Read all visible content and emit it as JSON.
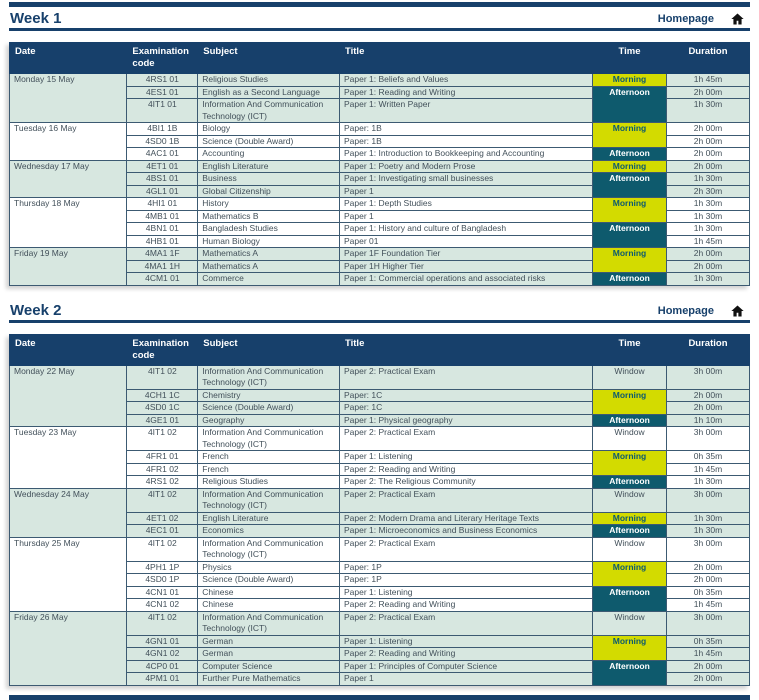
{
  "colors": {
    "navy": "#17406b",
    "row_mint": "#d7e7e0",
    "row_white": "#ffffff",
    "morning_bg": "#d3db00",
    "morning_text": "#0d5a6e",
    "afternoon_bg": "#0e5a6d",
    "afternoon_text": "#ffffff"
  },
  "columns": [
    "Date",
    "Examination code",
    "Subject",
    "Title",
    "Time",
    "Duration"
  ],
  "weeks": [
    {
      "title": "Week 1",
      "homepage_label": "Homepage",
      "days": [
        {
          "date": "Monday 15 May",
          "exams": [
            {
              "code": "4RS1 01",
              "subject": "Religious Studies",
              "title": "Paper 1: Beliefs and Values",
              "time": "Morning",
              "time_span": 1,
              "duration": "1h 45m"
            },
            {
              "code": "4ES1 01",
              "subject": "English as a Second Language",
              "title": "Paper 1: Reading and Writing",
              "time": "Afternoon",
              "time_span": 2,
              "duration": "2h 00m"
            },
            {
              "code": "4IT1 01",
              "subject": "Information And Communication Technology (ICT)",
              "title": "Paper 1: Written Paper",
              "duration": "1h 30m"
            }
          ]
        },
        {
          "date": "Tuesday 16 May",
          "exams": [
            {
              "code": "4BI1 1B",
              "subject": "Biology",
              "title": "Paper: 1B",
              "time": "Morning",
              "time_span": 2,
              "duration": "2h 00m"
            },
            {
              "code": "4SD0 1B",
              "subject": "Science (Double Award)",
              "title": "Paper: 1B",
              "duration": "2h 00m"
            },
            {
              "code": "4AC1 01",
              "subject": "Accounting",
              "title": "Paper 1: Introduction to Bookkeeping and Accounting",
              "time": "Afternoon",
              "time_span": 1,
              "duration": "2h 00m"
            }
          ]
        },
        {
          "date": "Wednesday 17 May",
          "exams": [
            {
              "code": "4ET1 01",
              "subject": "English Literature",
              "title": "Paper 1: Poetry and Modern Prose",
              "time": "Morning",
              "time_span": 1,
              "duration": "2h 00m"
            },
            {
              "code": "4BS1 01",
              "subject": "Business",
              "title": "Paper 1: Investigating small businesses",
              "time": "Afternoon",
              "time_span": 2,
              "duration": "1h 30m"
            },
            {
              "code": "4GL1 01",
              "subject": "Global Citizenship",
              "title": "Paper 1",
              "duration": "2h 30m"
            }
          ]
        },
        {
          "date": "Thursday 18 May",
          "exams": [
            {
              "code": "4HI1 01",
              "subject": "History",
              "title": "Paper 1: Depth Studies",
              "time": "Morning",
              "time_span": 2,
              "duration": "1h 30m"
            },
            {
              "code": "4MB1 01",
              "subject": "Mathematics B",
              "title": "Paper 1",
              "duration": "1h 30m"
            },
            {
              "code": "4BN1 01",
              "subject": "Bangladesh Studies",
              "title": "Paper 1: History and culture of Bangladesh",
              "time": "Afternoon",
              "time_span": 2,
              "duration": "1h 30m"
            },
            {
              "code": "4HB1 01",
              "subject": "Human Biology",
              "title": "Paper 01",
              "duration": "1h 45m"
            }
          ]
        },
        {
          "date": "Friday 19 May",
          "exams": [
            {
              "code": "4MA1 1F",
              "subject": "Mathematics A",
              "title": "Paper 1F Foundation Tier",
              "time": "Morning",
              "time_span": 2,
              "duration": "2h 00m"
            },
            {
              "code": "4MA1 1H",
              "subject": "Mathematics A",
              "title": "Paper 1H Higher Tier",
              "duration": "2h 00m"
            },
            {
              "code": "4CM1 01",
              "subject": "Commerce",
              "title": "Paper 1: Commercial operations and associated risks",
              "time": "Afternoon",
              "time_span": 1,
              "duration": "1h 30m"
            }
          ]
        }
      ]
    },
    {
      "title": "Week 2",
      "homepage_label": "Homepage",
      "days": [
        {
          "date": "Monday 22 May",
          "exams": [
            {
              "code": "4IT1 02",
              "subject": "Information And Communication Technology (ICT)",
              "title": "Paper 2: Practical Exam",
              "time": "Window",
              "time_span": 1,
              "duration": "3h 00m"
            },
            {
              "code": "4CH1 1C",
              "subject": "Chemistry",
              "title": "Paper: 1C",
              "time": "Morning",
              "time_span": 2,
              "duration": "2h 00m"
            },
            {
              "code": "4SD0 1C",
              "subject": "Science (Double Award)",
              "title": "Paper: 1C",
              "duration": "2h 00m"
            },
            {
              "code": "4GE1 01",
              "subject": "Geography",
              "title": "Paper 1: Physical geography",
              "time": "Afternoon",
              "time_span": 1,
              "duration": "1h 10m"
            }
          ]
        },
        {
          "date": "Tuesday 23 May",
          "exams": [
            {
              "code": "4IT1 02",
              "subject": "Information And Communication Technology (ICT)",
              "title": "Paper 2: Practical Exam",
              "time": "Window",
              "time_span": 1,
              "duration": "3h 00m"
            },
            {
              "code": "4FR1 01",
              "subject": "French",
              "title": "Paper 1: Listening",
              "time": "Morning",
              "time_span": 2,
              "duration": "0h 35m"
            },
            {
              "code": "4FR1 02",
              "subject": "French",
              "title": "Paper 2: Reading and Writing",
              "duration": "1h 45m"
            },
            {
              "code": "4RS1 02",
              "subject": "Religious Studies",
              "title": "Paper 2: The Religious Community",
              "time": "Afternoon",
              "time_span": 1,
              "duration": "1h 30m"
            }
          ]
        },
        {
          "date": "Wednesday 24 May",
          "exams": [
            {
              "code": "4IT1 02",
              "subject": "Information And Communication Technology (ICT)",
              "title": "Paper 2: Practical Exam",
              "time": "Window",
              "time_span": 1,
              "duration": "3h 00m"
            },
            {
              "code": "4ET1 02",
              "subject": "English Literature",
              "title": "Paper 2: Modern Drama and Literary Heritage Texts",
              "time": "Morning",
              "time_span": 1,
              "duration": "1h 30m"
            },
            {
              "code": "4EC1 01",
              "subject": "Economics",
              "title": "Paper 1: Microeconomics and Business Economics",
              "time": "Afternoon",
              "time_span": 1,
              "duration": "1h 30m"
            }
          ]
        },
        {
          "date": "Thursday 25 May",
          "exams": [
            {
              "code": "4IT1 02",
              "subject": "Information And Communication Technology (ICT)",
              "title": "Paper 2: Practical Exam",
              "time": "Window",
              "time_span": 1,
              "duration": "3h 00m"
            },
            {
              "code": "4PH1 1P",
              "subject": "Physics",
              "title": "Paper: 1P",
              "time": "Morning",
              "time_span": 2,
              "duration": "2h 00m"
            },
            {
              "code": "4SD0 1P",
              "subject": "Science (Double Award)",
              "title": "Paper: 1P",
              "duration": "2h 00m"
            },
            {
              "code": "4CN1 01",
              "subject": "Chinese",
              "title": "Paper 1: Listening",
              "time": "Afternoon",
              "time_span": 2,
              "duration": "0h 35m"
            },
            {
              "code": "4CN1 02",
              "subject": "Chinese",
              "title": "Paper 2: Reading and Writing",
              "duration": "1h 45m"
            }
          ]
        },
        {
          "date": "Friday 26 May",
          "exams": [
            {
              "code": "4IT1 02",
              "subject": "Information And Communication Technology (ICT)",
              "title": "Paper 2: Practical Exam",
              "time": "Window",
              "time_span": 1,
              "duration": "3h 00m"
            },
            {
              "code": "4GN1 01",
              "subject": "German",
              "title": "Paper 1: Listening",
              "time": "Morning",
              "time_span": 2,
              "duration": "0h 35m"
            },
            {
              "code": "4GN1 02",
              "subject": "German",
              "title": "Paper 2: Reading and Writing",
              "duration": "1h 45m"
            },
            {
              "code": "4CP0 01",
              "subject": "Computer Science",
              "title": "Paper 1: Principles of Computer Science",
              "time": "Afternoon",
              "time_span": 2,
              "duration": "2h 00m"
            },
            {
              "code": "4PM1 01",
              "subject": "Further Pure Mathematics",
              "title": "Paper 1",
              "duration": "2h 00m"
            }
          ]
        }
      ]
    }
  ]
}
